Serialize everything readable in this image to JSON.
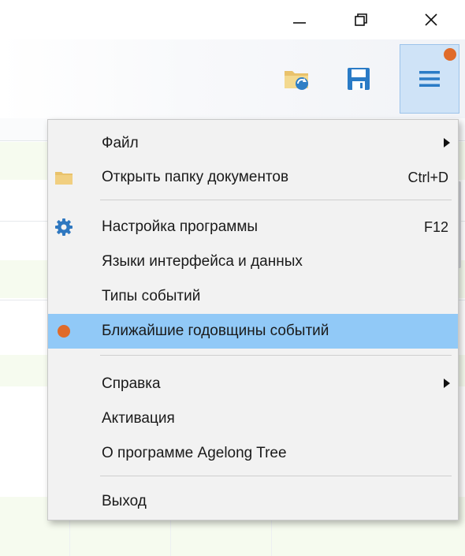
{
  "window": {
    "controls": {
      "minimize_icon": "minimize-icon",
      "restore_icon": "restore-icon",
      "close_icon": "close-icon"
    }
  },
  "toolbar": {
    "open_folder_icon": "folder-open-icon",
    "save_icon": "save-icon",
    "menu_icon": "hamburger-menu-icon",
    "notification_color": "#e06b2a",
    "menu_button_active_color": "#cfe3f7"
  },
  "menu": {
    "highlight_color": "#91c9f7",
    "items": [
      {
        "label": "Файл",
        "shortcut": "",
        "submenu": true
      },
      {
        "label": "Открыть папку документов",
        "shortcut": "Ctrl+D",
        "icon": "folder-icon"
      },
      {
        "label": "Настройка программы",
        "shortcut": "F12",
        "icon": "gear-icon"
      },
      {
        "label": "Языки интерфейса и данных",
        "shortcut": ""
      },
      {
        "label": "Типы событий",
        "shortcut": ""
      },
      {
        "label": "Ближайшие годовщины событий",
        "shortcut": "",
        "icon": "orange-dot-icon",
        "highlighted": true
      },
      {
        "label": "Справка",
        "shortcut": "",
        "submenu": true
      },
      {
        "label": "Активация",
        "shortcut": ""
      },
      {
        "label": "О программе Agelong Tree",
        "shortcut": ""
      },
      {
        "label": "Выход",
        "shortcut": ""
      }
    ]
  }
}
